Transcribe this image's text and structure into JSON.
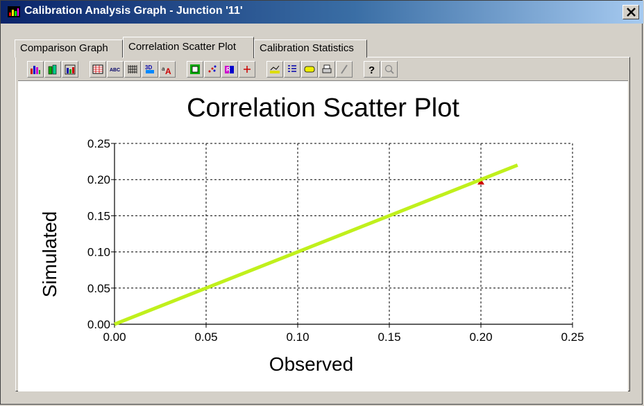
{
  "window": {
    "title": "Calibration Analysis Graph - Junction '11'"
  },
  "tabs": [
    {
      "label": "Comparison Graph",
      "active": false
    },
    {
      "label": "Correlation Scatter Plot",
      "active": true
    },
    {
      "label": "Calibration Statistics",
      "active": false
    }
  ],
  "toolbar": {
    "buttons": [
      "bar-chart-icon",
      "3d-bar-chart-icon",
      "grouped-bar-chart-icon",
      "data-grid-icon",
      "abc-label-icon",
      "table-icon",
      "3d-view-icon",
      "font-icon",
      "border-icon",
      "scatter-icon",
      "color-scheme-icon",
      "crosshair-icon",
      "chart-type-icon",
      "legend-icon",
      "tag-icon",
      "print-icon",
      "pen-icon",
      "help-icon",
      "zoom-icon"
    ]
  },
  "chart_data": {
    "type": "scatter",
    "title": "Correlation Scatter Plot",
    "xlabel": "Observed",
    "ylabel": "Simulated",
    "xlim": [
      0.0,
      0.25
    ],
    "ylim": [
      0.0,
      0.25
    ],
    "xticks": [
      "0.00",
      "0.05",
      "0.10",
      "0.15",
      "0.20",
      "0.25"
    ],
    "yticks": [
      "0.00",
      "0.05",
      "0.10",
      "0.15",
      "0.20",
      "0.25"
    ],
    "grid": true,
    "series": [
      {
        "kind": "line",
        "color": "#c0f01c",
        "x": [
          0.0,
          0.22
        ],
        "y": [
          0.0,
          0.22
        ]
      },
      {
        "kind": "points",
        "color": "#cc0000",
        "marker": "triangle",
        "x": [
          0.2
        ],
        "y": [
          0.197
        ]
      }
    ]
  }
}
